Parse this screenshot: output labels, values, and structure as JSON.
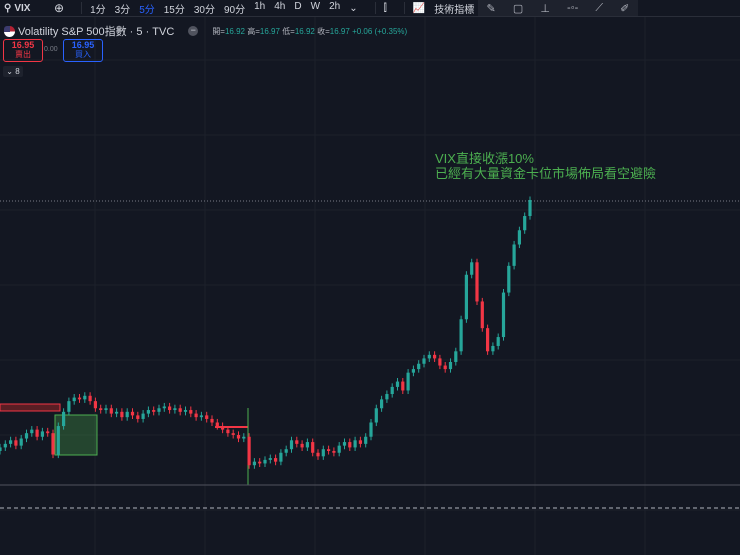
{
  "toolbar": {
    "symbol": "VIX",
    "intervals": [
      "1分",
      "3分",
      "5分",
      "15分",
      "30分",
      "90分",
      "1h",
      "4h",
      "D",
      "W",
      "2h"
    ],
    "active_interval": "5分",
    "indicators_label": "技術指標"
  },
  "legend": {
    "title": "Volatility S&P 500指數 · 5 · TVC",
    "open_label": "開=",
    "open": "16.92",
    "high_label": "高=",
    "high": "16.97",
    "low_label": "低=",
    "low": "16.92",
    "close_label": "收=",
    "close": "16.97",
    "change": "+0.06 (+0.35%)"
  },
  "trade": {
    "sell_price": "16.95",
    "sell_label": "賣出",
    "spread": "0.00",
    "buy_price": "16.95",
    "buy_label": "買入",
    "collapsed_count": "8"
  },
  "annotation": {
    "line1": "VIX直接收漲10%",
    "line2": "已經有大量資金卡位市場佈局看空避險"
  },
  "colors": {
    "up": "#26a69a",
    "down": "#f23645",
    "annotation": "#4caf50"
  },
  "chart_data": {
    "type": "candlestick",
    "symbol": "VIX",
    "timeframe": "5",
    "closes": [
      15.58,
      15.6,
      15.62,
      15.59,
      15.63,
      15.66,
      15.68,
      15.64,
      15.67,
      15.66,
      15.54,
      15.7,
      15.78,
      15.84,
      15.86,
      15.85,
      15.87,
      15.84,
      15.8,
      15.79,
      15.8,
      15.77,
      15.78,
      15.75,
      15.78,
      15.76,
      15.74,
      15.77,
      15.79,
      15.78,
      15.8,
      15.81,
      15.79,
      15.8,
      15.78,
      15.79,
      15.77,
      15.75,
      15.76,
      15.74,
      15.72,
      15.7,
      15.68,
      15.66,
      15.65,
      15.63,
      15.64,
      15.48,
      15.5,
      15.49,
      15.51,
      15.52,
      15.5,
      15.55,
      15.57,
      15.62,
      15.6,
      15.58,
      15.61,
      15.55,
      15.53,
      15.57,
      15.56,
      15.55,
      15.59,
      15.61,
      15.58,
      15.62,
      15.6,
      15.64,
      15.72,
      15.8,
      15.85,
      15.88,
      15.92,
      15.95,
      15.9,
      16.0,
      16.02,
      16.05,
      16.08,
      16.1,
      16.08,
      16.04,
      16.02,
      16.06,
      16.12,
      16.3,
      16.55,
      16.62,
      16.4,
      16.25,
      16.12,
      16.15,
      16.2,
      16.45,
      16.6,
      16.72,
      16.8,
      16.88,
      16.97
    ],
    "last_price": 16.97
  }
}
